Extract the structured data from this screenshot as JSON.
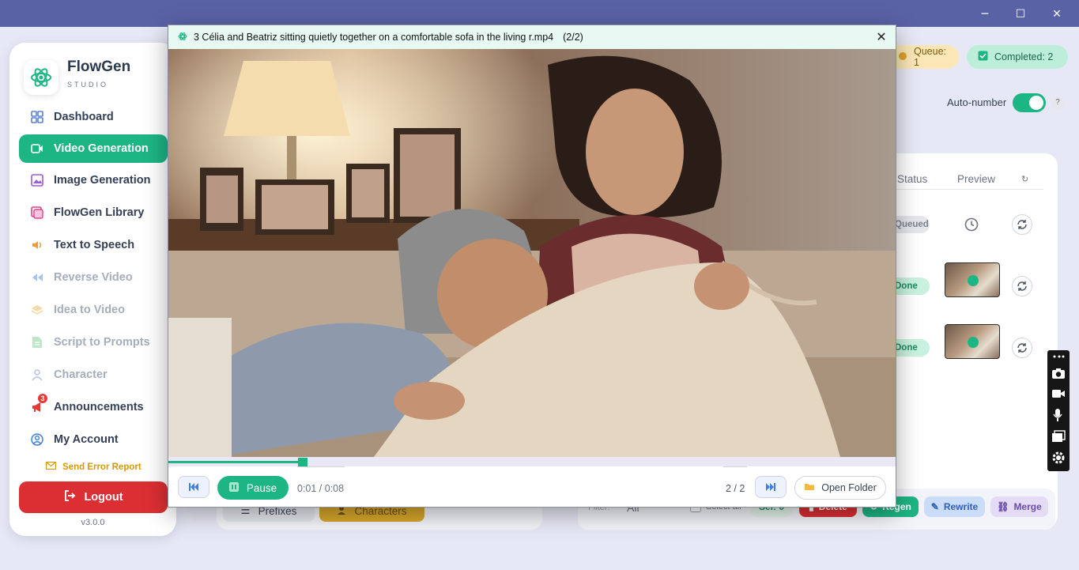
{
  "window": {
    "minimize": "─",
    "maximize": "☐",
    "close": "✕"
  },
  "brand": {
    "name": "FlowGen",
    "subtitle": "STUDIO"
  },
  "nav": [
    {
      "label": "Dashboard"
    },
    {
      "label": "Video Generation"
    },
    {
      "label": "Image Generation"
    },
    {
      "label": "FlowGen Library"
    },
    {
      "label": "Text to Speech"
    },
    {
      "label": "Reverse Video"
    },
    {
      "label": "Idea to Video"
    },
    {
      "label": "Script to Prompts"
    },
    {
      "label": "Character"
    },
    {
      "label": "Announcements",
      "badge": "3"
    },
    {
      "label": "My Account"
    }
  ],
  "sidebar_footer": {
    "error_report": "Send Error Report",
    "logout": "Logout",
    "version": "v3.0.0"
  },
  "status_chips": {
    "queue": "Queue: 1",
    "completed": "Completed: 2"
  },
  "auto_number": {
    "label": "Auto-number",
    "help": "?",
    "enabled": true
  },
  "table": {
    "headers": {
      "status": "Status",
      "preview": "Preview"
    },
    "rows": [
      {
        "status": "Queued"
      },
      {
        "status": "Done"
      },
      {
        "status": "Done"
      }
    ]
  },
  "bottom_left": {
    "prefixes": "Prefixes",
    "characters": "Characters"
  },
  "bottom_right": {
    "filter_label": "Filter:",
    "filter_value": "All",
    "select_all": "Select all",
    "sel": "Sel: 0",
    "delete": "Delete",
    "regen": "Regen",
    "rewrite": "Rewrite",
    "merge": "Merge"
  },
  "player": {
    "title": "3 Célia and Beatriz sitting quietly together on a comfortable sofa in the living r.mp4",
    "index": "(2/2)",
    "pause": "Pause",
    "time": "0:01 / 0:08",
    "count": "2 / 2",
    "open_folder": "Open Folder",
    "progress": 0.185
  },
  "colors": {
    "accent": "#1eb584",
    "danger": "#dc2f33",
    "window": "#5a62a6"
  }
}
